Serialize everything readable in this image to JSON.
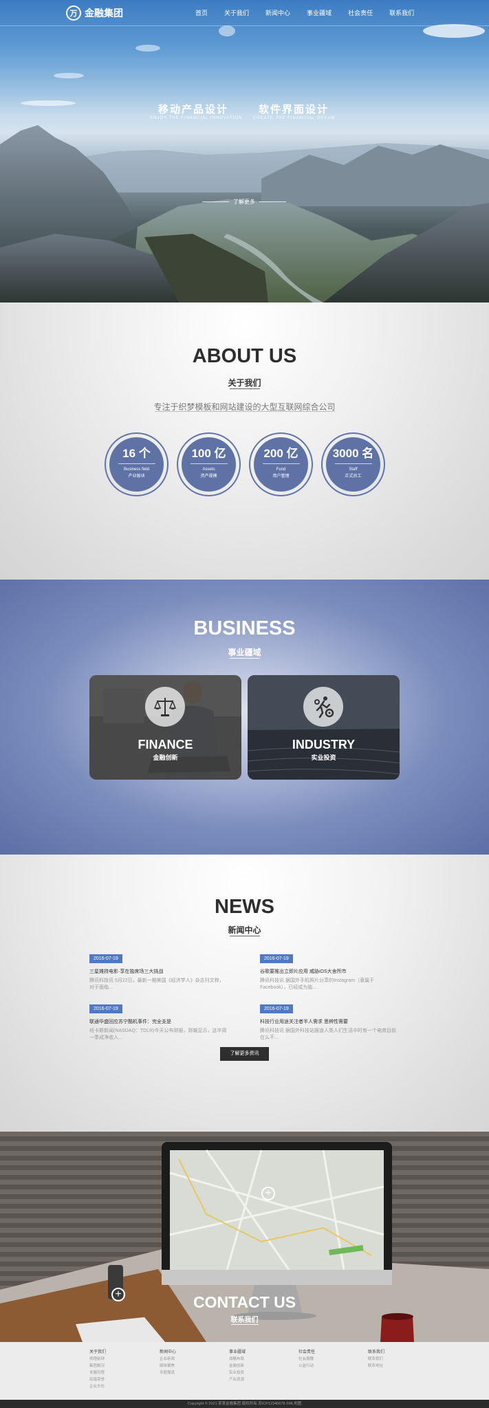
{
  "header": {
    "logo_mark": "万",
    "logo_text": "金融集团",
    "nav": [
      "首页",
      "关于我们",
      "新闻中心",
      "事业疆域",
      "社会责任",
      "联系我们"
    ]
  },
  "hero": {
    "slides": [
      {
        "title": "移动产品设计",
        "subtitle": "ENJOY THE FINANCIAL INNOVATION"
      },
      {
        "title": "软件界面设计",
        "subtitle": "CREATE THE FINANCIAL DREAM"
      }
    ],
    "more_label": "了解更多"
  },
  "about": {
    "title": "ABOUT US",
    "subtitle": "关于我们",
    "description": "专注于织梦模板和网站建设的大型互联网综合公司",
    "stats": [
      {
        "value": "16 个",
        "en": "Business field",
        "cn": "产业板块"
      },
      {
        "value": "100 亿",
        "en": "Assets",
        "cn": "资产规模"
      },
      {
        "value": "200 亿",
        "en": "Fund",
        "cn": "用户管理"
      },
      {
        "value": "3000 名",
        "en": "Staff",
        "cn": "正式员工"
      }
    ]
  },
  "business": {
    "title": "BUSINESS",
    "subtitle": "事业疆域",
    "cards": [
      {
        "title": "FINANCE",
        "subtitle": "金融创新",
        "icon": "scales-icon"
      },
      {
        "title": "INDUSTRY",
        "subtitle": "实业投资",
        "icon": "industry-gears-icon"
      }
    ]
  },
  "news": {
    "title": "NEWS",
    "subtitle": "新闻中心",
    "items": [
      {
        "date": "2016-07-19",
        "title": "三星摊持电影·享在独席场三大挑战",
        "text": "腾讯科技讯 5月22日，最新一期美国《经济学人》杂志刊文称，对于面临..."
      },
      {
        "date": "2016-07-19",
        "title": "谷歌要推出立即片应用 威胁iOS大舍所市",
        "text": "腾讯科技讯 据国外手机照片分享的Instagram（隶属于Facebook），已经成为独..."
      },
      {
        "date": "2016-07-19",
        "title": "联通华盛回应苏宁酷机事件：完全支是",
        "text": "纽卡斯新闻(NASDAQ：TDLR)今天公布财报，财報显示，这半周一季成净收入..."
      },
      {
        "date": "2016-07-19",
        "title": "科技行业用途关注者半人需求 思辨性需要",
        "text": "腾讯科技讯 据国外科技站报道人类人们生活中时有一个电商目前在么不..."
      }
    ],
    "more_label": "了解更多资讯"
  },
  "contact": {
    "title": "CONTACT US",
    "subtitle": "联系我们"
  },
  "footer": {
    "columns": [
      {
        "head": "关于我们",
        "links": [
          "明理前钟",
          "集团概况",
          "发展历程",
          "底蕴荣誉",
          "企业文化"
        ]
      },
      {
        "head": "新闻中心",
        "links": [
          "企业新闻",
          "媒体聚焦",
          "专题报道"
        ]
      },
      {
        "head": "事业疆域",
        "links": [
          "战略布局",
          "金融创新",
          "实业投资",
          "产业资源"
        ]
      },
      {
        "head": "社会责任",
        "links": [
          "社会捐赠",
          "公益行动"
        ]
      },
      {
        "head": "联系我们",
        "links": [
          "联系我们",
          "联系地址"
        ]
      }
    ],
    "copyright": "Copyright © 2021 某某金融集团 版权所有 苏ICP12345678 XML地图"
  }
}
